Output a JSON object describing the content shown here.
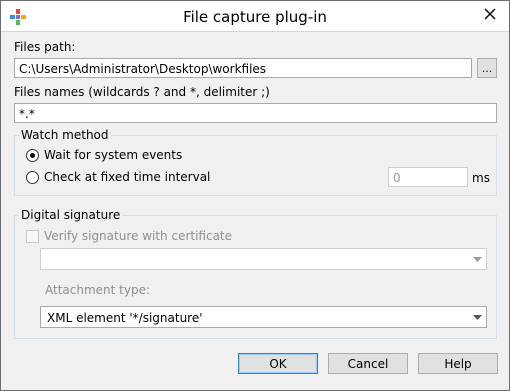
{
  "window": {
    "title": "File capture plug-in"
  },
  "files_path": {
    "label": "Files path:",
    "value": "C:\\Users\\Administrator\\Desktop\\workfiles",
    "browse_label": "..."
  },
  "file_names": {
    "label": "Files names (wildcards ? and *, delimiter ;)",
    "value": "*.*"
  },
  "watch_method": {
    "legend": "Watch method",
    "option_events": "Wait for system events",
    "option_interval": "Check at fixed time interval",
    "interval_value": "0",
    "interval_unit": "ms",
    "selected": "events"
  },
  "digital_signature": {
    "legend": "Digital signature",
    "verify_label": "Verify signature with certificate",
    "verify_checked": false,
    "certificate_value": "",
    "attachment_label": "Attachment type:",
    "attachment_value": "XML element '*/signature'"
  },
  "buttons": {
    "ok": "OK",
    "cancel": "Cancel",
    "help": "Help"
  }
}
